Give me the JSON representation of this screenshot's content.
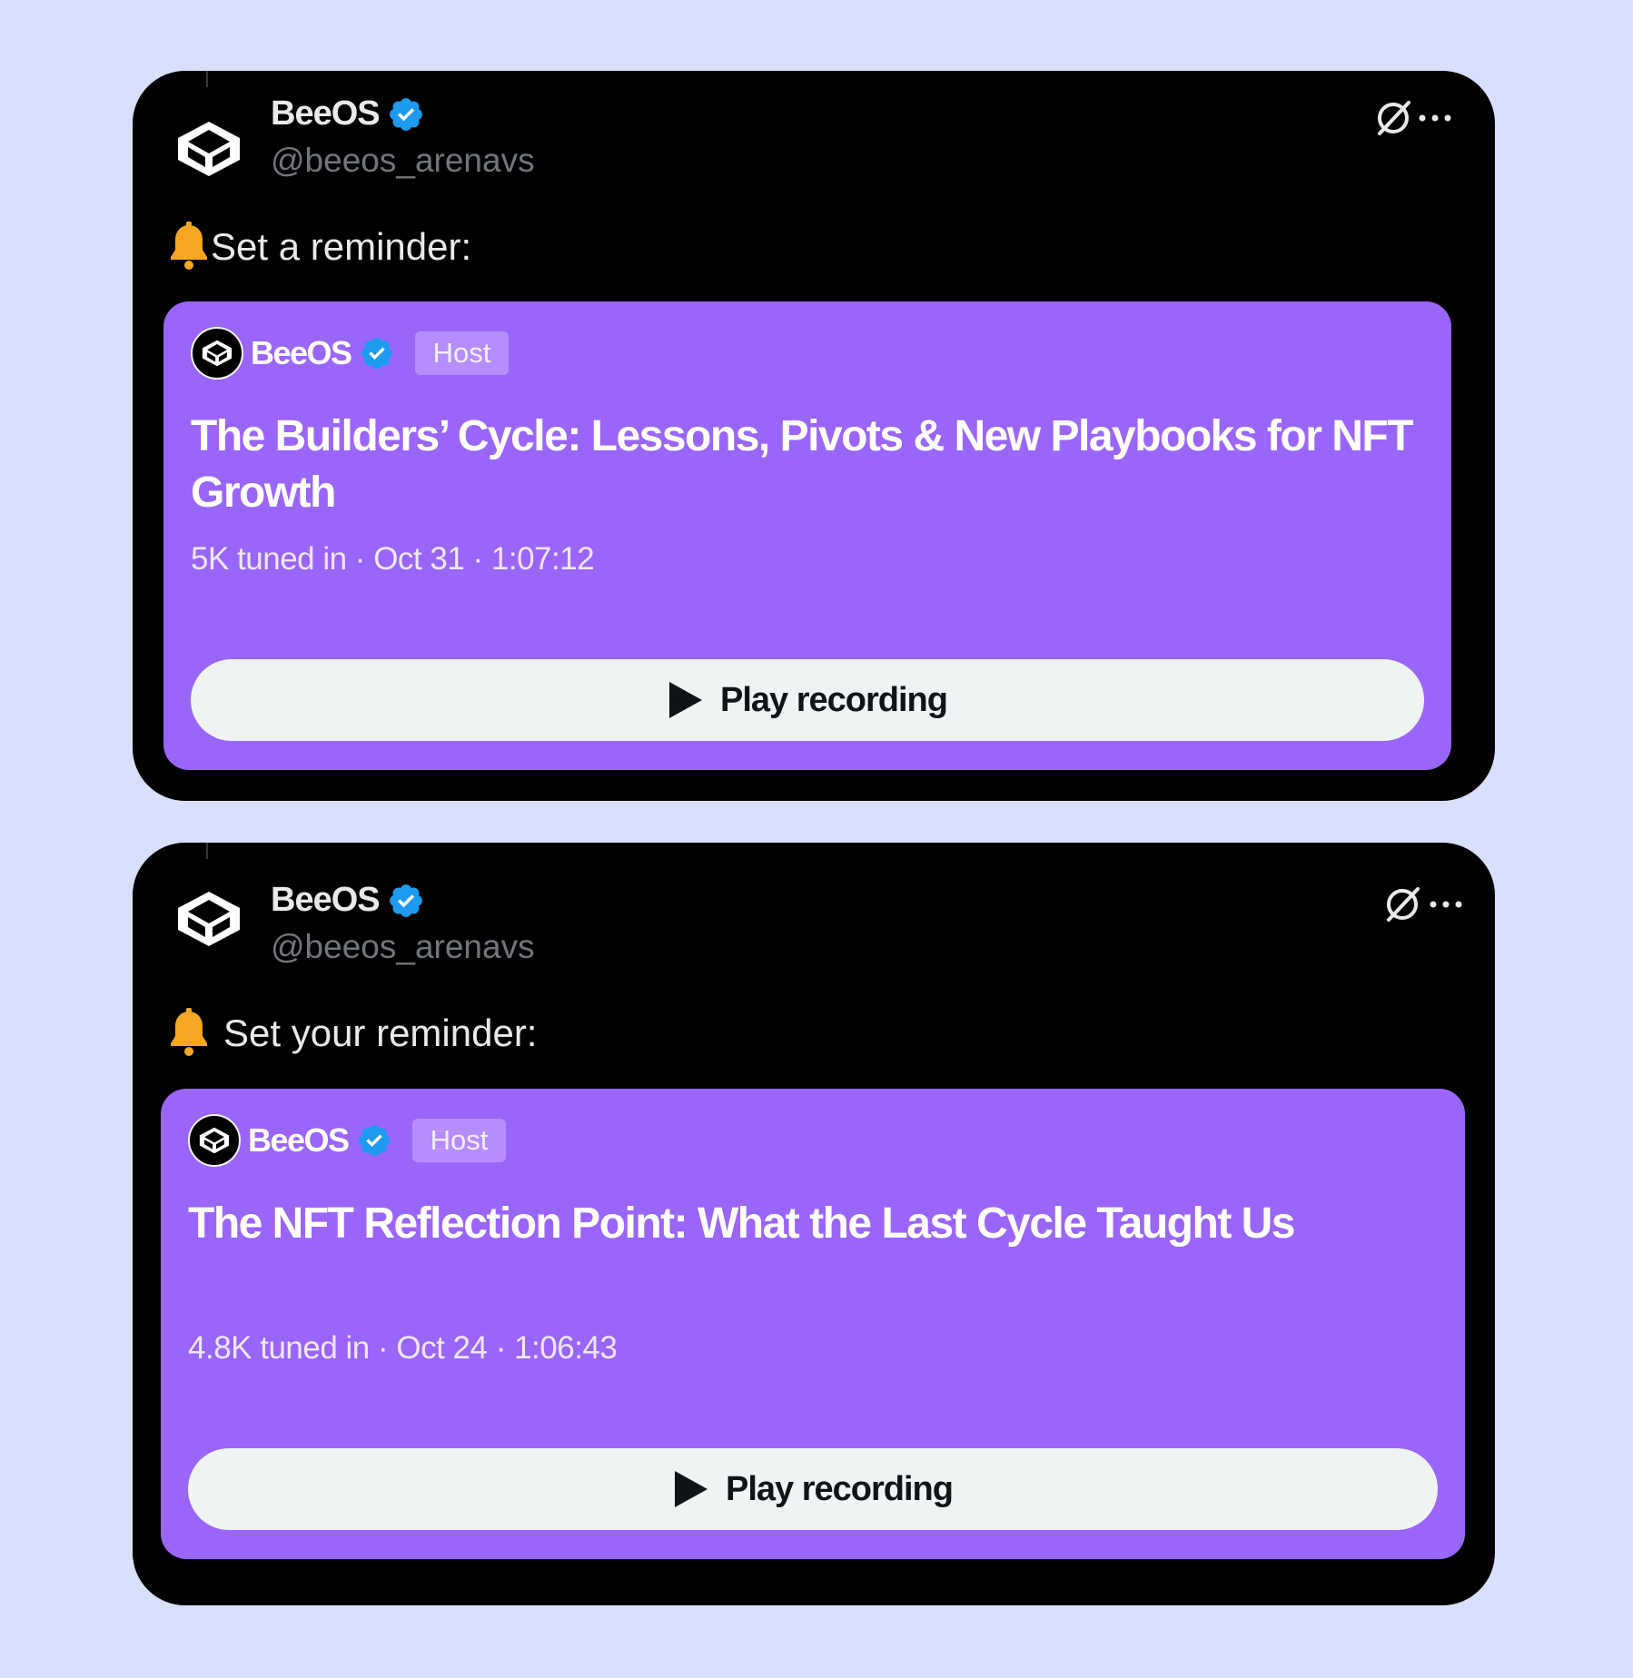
{
  "colors": {
    "background": "#d8e0fe",
    "card": "#000000",
    "space_card": "#9a66f9",
    "verified": "#1d9bf0",
    "bell": "#f5a623"
  },
  "icons": {
    "bell": "bell-icon",
    "verified": "verified-badge-icon",
    "grok": "grok-icon",
    "more": "more-icon",
    "play": "play-icon",
    "avatar": "beeos-logo-icon"
  },
  "posts": [
    {
      "author_name": "BeeOS",
      "author_handle": "@beeos_arenavs",
      "text": "Set a reminder:",
      "space": {
        "host_name": "BeeOS",
        "host_badge": "Host",
        "title": "The Builders’ Cycle: Lessons, Pivots & New Playbooks for NFT Growth",
        "meta": "5K tuned in · Oct 31 · 1:07:12",
        "play_label": "Play recording"
      }
    },
    {
      "author_name": "BeeOS",
      "author_handle": "@beeos_arenavs",
      "text": "Set your reminder:",
      "space": {
        "host_name": "BeeOS",
        "host_badge": "Host",
        "title": "The NFT Reflection Point: What the Last Cycle Taught Us",
        "meta": "4.8K tuned in · Oct 24 · 1:06:43",
        "play_label": "Play recording"
      }
    }
  ]
}
